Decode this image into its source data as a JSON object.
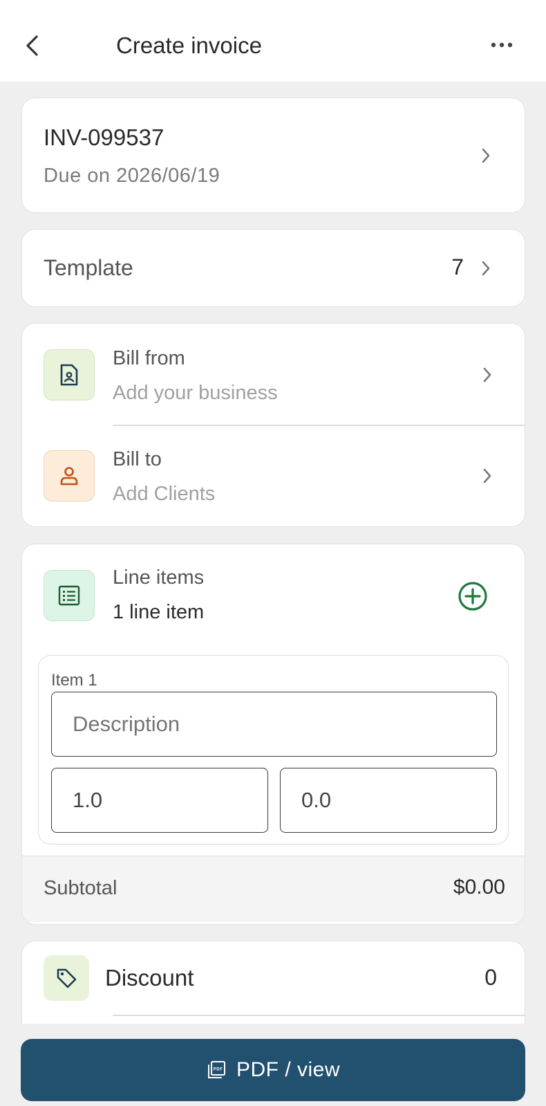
{
  "header": {
    "title": "Create invoice",
    "back_icon": "chevron-left-icon",
    "more_icon": "more-horizontal-icon"
  },
  "invoice": {
    "number": "INV-099537",
    "due": "Due on 2026/06/19"
  },
  "template": {
    "label": "Template",
    "value": "7"
  },
  "bill_from": {
    "title": "Bill from",
    "subtitle": "Add your business",
    "icon": "business-card-icon",
    "icon_bg": "#e8f3da"
  },
  "bill_to": {
    "title": "Bill to",
    "subtitle": "Add Clients",
    "icon": "user-icon",
    "icon_bg": "#fdecd9"
  },
  "line_items": {
    "title": "Line items",
    "count_label": "1 line item",
    "icon": "list-icon",
    "icon_bg": "#ddf5e6",
    "add_icon": "plus-circle-icon",
    "accent": "#1e7a3e",
    "items": [
      {
        "label": "Item 1",
        "description_placeholder": "Description",
        "quantity": "1.0",
        "rate": "0.0"
      }
    ],
    "subtotal_label": "Subtotal",
    "subtotal_value": "$0.00"
  },
  "discount": {
    "title": "Discount",
    "value": "0",
    "icon": "tag-icon",
    "icon_bg": "#e8f3da"
  },
  "footer": {
    "pdf_label": "PDF / view",
    "pdf_icon": "pdf-icon",
    "button_color": "#22506f"
  }
}
